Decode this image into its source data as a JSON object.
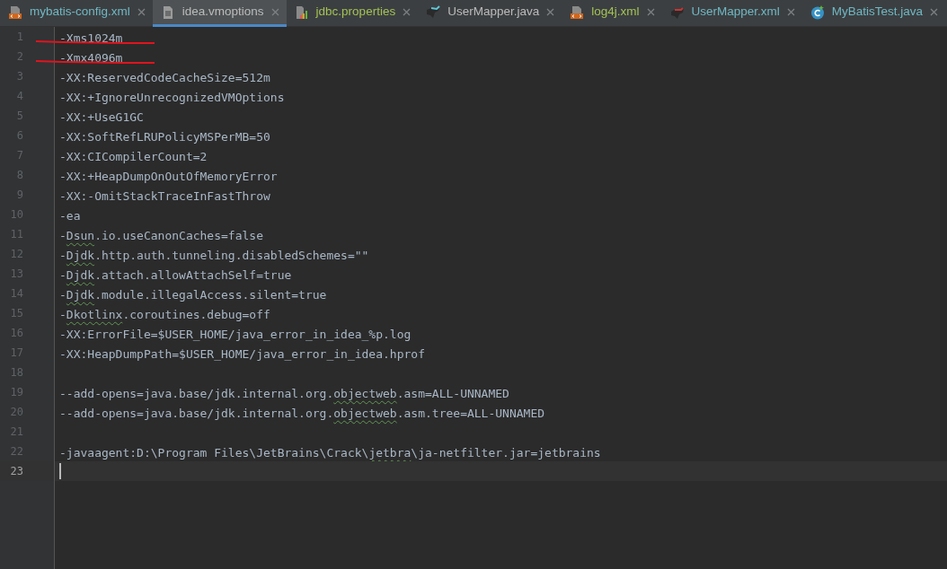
{
  "tabs": [
    {
      "label": "mybatis-config.xml",
      "kind": "xml",
      "color": "#6fb8c4",
      "selected": false
    },
    {
      "label": "idea.vmoptions",
      "kind": "doc",
      "color": "#bbbbbb",
      "selected": true
    },
    {
      "label": "jdbc.properties",
      "kind": "properties",
      "color": "#a3c255",
      "selected": false
    },
    {
      "label": "UserMapper.java",
      "kind": "mapper",
      "color": "#bbbbbb",
      "selected": false
    },
    {
      "label": "log4j.xml",
      "kind": "xml",
      "color": "#a3c255",
      "selected": false
    },
    {
      "label": "UserMapper.xml",
      "kind": "mapperxml",
      "color": "#6fb8c4",
      "selected": false
    },
    {
      "label": "MyBatisTest.java",
      "kind": "class",
      "color": "#6fb8c4",
      "selected": false
    }
  ],
  "lines": [
    {
      "number": "1",
      "segments": [
        {
          "text": "-Xms1024m",
          "typo": false
        }
      ],
      "marked": true,
      "current": false
    },
    {
      "number": "2",
      "segments": [
        {
          "text": "-Xmx4096m",
          "typo": false
        }
      ],
      "marked": true,
      "current": false
    },
    {
      "number": "3",
      "segments": [
        {
          "text": "-XX:ReservedCodeCacheSize=512m",
          "typo": false
        }
      ],
      "marked": false,
      "current": false
    },
    {
      "number": "4",
      "segments": [
        {
          "text": "-XX:+IgnoreUnrecognizedVMOptions",
          "typo": false
        }
      ],
      "marked": false,
      "current": false
    },
    {
      "number": "5",
      "segments": [
        {
          "text": "-XX:+UseG1GC",
          "typo": false
        }
      ],
      "marked": false,
      "current": false
    },
    {
      "number": "6",
      "segments": [
        {
          "text": "-XX:SoftRefLRUPolicyMSPerMB=50",
          "typo": false
        }
      ],
      "marked": false,
      "current": false
    },
    {
      "number": "7",
      "segments": [
        {
          "text": "-XX:CICompilerCount=2",
          "typo": false
        }
      ],
      "marked": false,
      "current": false
    },
    {
      "number": "8",
      "segments": [
        {
          "text": "-XX:+HeapDumpOnOutOfMemoryError",
          "typo": false
        }
      ],
      "marked": false,
      "current": false
    },
    {
      "number": "9",
      "segments": [
        {
          "text": "-XX:-OmitStackTraceInFastThrow",
          "typo": false
        }
      ],
      "marked": false,
      "current": false
    },
    {
      "number": "10",
      "segments": [
        {
          "text": "-ea",
          "typo": false
        }
      ],
      "marked": false,
      "current": false
    },
    {
      "number": "11",
      "segments": [
        {
          "text": "-",
          "typo": false
        },
        {
          "text": "Dsun",
          "typo": true
        },
        {
          "text": ".io.useCanonCaches=false",
          "typo": false
        }
      ],
      "marked": false,
      "current": false
    },
    {
      "number": "12",
      "segments": [
        {
          "text": "-",
          "typo": false
        },
        {
          "text": "Djdk",
          "typo": true
        },
        {
          "text": ".http.auth.tunneling.disabledSchemes=\"\"",
          "typo": false
        }
      ],
      "marked": false,
      "current": false
    },
    {
      "number": "13",
      "segments": [
        {
          "text": "-",
          "typo": false
        },
        {
          "text": "Djdk",
          "typo": true
        },
        {
          "text": ".attach.allowAttachSelf=true",
          "typo": false
        }
      ],
      "marked": false,
      "current": false
    },
    {
      "number": "14",
      "segments": [
        {
          "text": "-",
          "typo": false
        },
        {
          "text": "Djdk",
          "typo": true
        },
        {
          "text": ".module.illegalAccess.silent=true",
          "typo": false
        }
      ],
      "marked": false,
      "current": false
    },
    {
      "number": "15",
      "segments": [
        {
          "text": "-",
          "typo": false
        },
        {
          "text": "Dkotlinx",
          "typo": true
        },
        {
          "text": ".coroutines.debug=off",
          "typo": false
        }
      ],
      "marked": false,
      "current": false
    },
    {
      "number": "16",
      "segments": [
        {
          "text": "-XX:ErrorFile=$USER_HOME/java_error_in_idea_%p.log",
          "typo": false
        }
      ],
      "marked": false,
      "current": false
    },
    {
      "number": "17",
      "segments": [
        {
          "text": "-XX:HeapDumpPath=$USER_HOME/java_error_in_idea.hprof",
          "typo": false
        }
      ],
      "marked": false,
      "current": false
    },
    {
      "number": "18",
      "marked": false,
      "current": false
    },
    {
      "number": "19",
      "segments": [
        {
          "text": "--add-opens=java.base/jdk.internal.org.",
          "typo": false
        },
        {
          "text": "objectweb",
          "typo": true
        },
        {
          "text": ".asm=ALL-UNNAMED",
          "typo": false
        }
      ],
      "marked": false,
      "current": false
    },
    {
      "number": "20",
      "segments": [
        {
          "text": "--add-opens=java.base/jdk.internal.org.",
          "typo": false
        },
        {
          "text": "objectweb",
          "typo": true
        },
        {
          "text": ".asm.tree=ALL-UNNAMED",
          "typo": false
        }
      ],
      "marked": false,
      "current": false
    },
    {
      "number": "21",
      "marked": false,
      "current": false
    },
    {
      "number": "22",
      "segments": [
        {
          "text": "-javaagent:D:\\Program Files\\JetBrains\\Crack\\",
          "typo": false
        },
        {
          "text": "jetbra",
          "typo": true
        },
        {
          "text": "\\ja-netfilter.jar=jetbrains",
          "typo": false
        }
      ],
      "marked": false,
      "current": false
    },
    {
      "number": "23",
      "marked": false,
      "current": true
    }
  ]
}
